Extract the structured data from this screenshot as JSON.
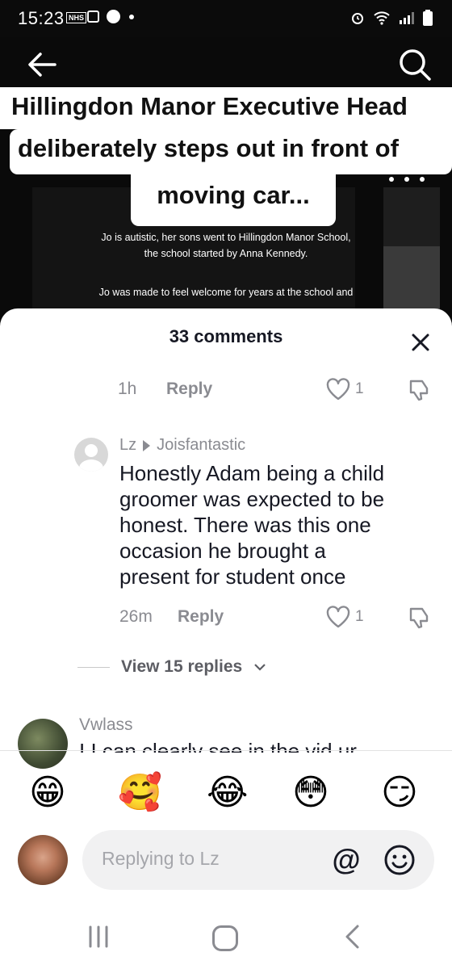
{
  "status_bar": {
    "time": "15:23",
    "nhs_badge": "NHS"
  },
  "video": {
    "headline_line1": "Hillingdon Manor Executive Head",
    "headline_line2": "deliberately steps out in front of",
    "headline_line3": "moving car...",
    "caption_line1": "Jo is autistic, her sons went to Hillingdon Manor School,",
    "caption_line2": "the school started by Anna Kennedy.",
    "caption_line3": "Jo was made to feel welcome for years at the school and"
  },
  "comments": {
    "count_label": "33 comments",
    "first_meta": {
      "time": "1h",
      "reply": "Reply",
      "likes": "1"
    },
    "second": {
      "user": "Lz",
      "reply_to": "Joisfantastic",
      "text_line1": "Honestly Adam being a child",
      "text_line2": "groomer was expected to be",
      "text_line3": "honest. There was this one",
      "text_line4": "occasion he brought a",
      "text_line5": "present for student once",
      "time": "26m",
      "reply": "Reply",
      "likes": "1"
    },
    "view_replies": "View 15 replies",
    "third": {
      "user": "Vwlass",
      "text": "I I can clearly see in the vid ur"
    }
  },
  "emoji_bar": [
    "😁",
    "🥰",
    "😂",
    "😳",
    "😏"
  ],
  "composer": {
    "placeholder": "Replying to Lz",
    "at_symbol": "@"
  },
  "colors": {
    "text_primary": "#161823",
    "text_secondary": "#8a8b91",
    "sheet_bg": "#ffffff"
  }
}
